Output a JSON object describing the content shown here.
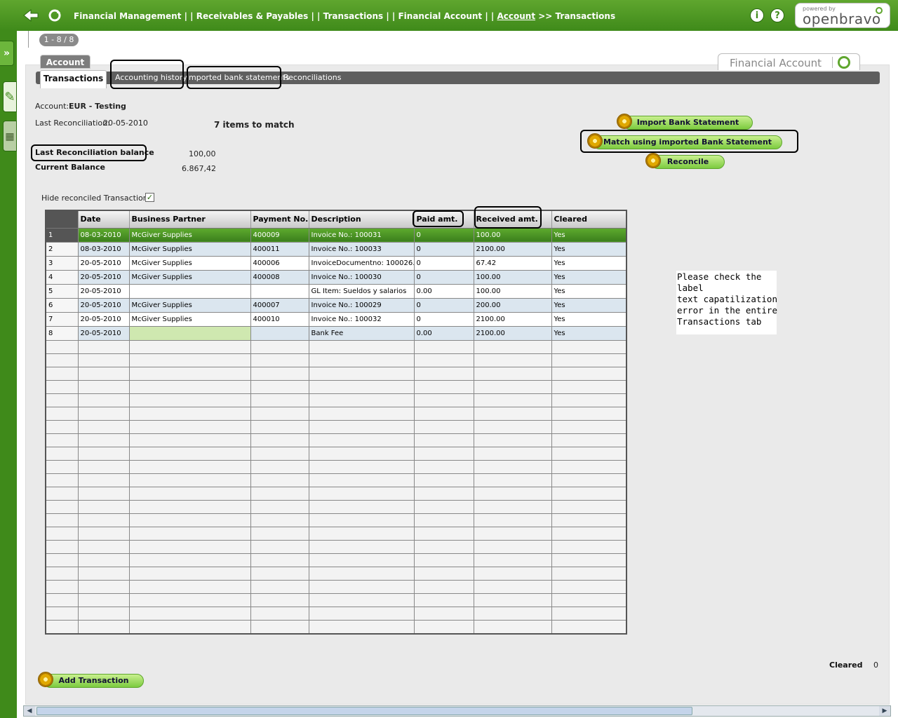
{
  "breadcrumb": {
    "parts": "Financial Management  | |  Receivables & Payables  | |  Transactions  | |  Financial Account   | |",
    "link": "Account",
    "rest": ">>  Transactions"
  },
  "logo": {
    "small": "powered by",
    "big": "openbravo"
  },
  "pager": "1 - 8 / 8",
  "tabs": {
    "account": "Account",
    "financial_account": "Financial Account",
    "transactions": "Transactions",
    "accounting_history": "Accounting history",
    "imported": "mported bank statements",
    "reconciliations": "Reconciliations"
  },
  "info": {
    "account_label": "Account:",
    "account_value": "EUR - Testing",
    "last_recon_label": "Last Reconciliation:",
    "last_recon_value": "20-05-2010",
    "items_to_match": "7  items to match",
    "last_recon_balance_label": "Last Reconciliation balance",
    "last_recon_balance_value": "100,00",
    "current_balance_label": "Current Balance",
    "current_balance_value": "6.867,42"
  },
  "buttons": {
    "import": "Import Bank Statement",
    "match": "Match using imported Bank Statement",
    "reconcile": "Reconcile",
    "add": "Add Transaction"
  },
  "hide_reconciled": {
    "label": "Hide reconciled Transactions",
    "checked": "✓"
  },
  "grid": {
    "columns": [
      "Date",
      "Business Partner",
      "Payment No.",
      "Description",
      "Paid amt.",
      "Received amt.",
      "Cleared"
    ],
    "rows": [
      {
        "n": "1",
        "date": "08-03-2010",
        "bp": "McGiver Supplies",
        "pay": "400009",
        "desc": "Invoice No.: 100031",
        "paid": "0",
        "recv": "100.00",
        "clr": "Yes"
      },
      {
        "n": "2",
        "date": "08-03-2010",
        "bp": "McGiver Supplies",
        "pay": "400011",
        "desc": "Invoice No.: 100033",
        "paid": "0",
        "recv": "2100.00",
        "clr": "Yes"
      },
      {
        "n": "3",
        "date": "20-05-2010",
        "bp": "McGiver Supplies",
        "pay": "400006",
        "desc": "InvoiceDocumentno: 100026.",
        "paid": "0",
        "recv": "67.42",
        "clr": "Yes"
      },
      {
        "n": "4",
        "date": "20-05-2010",
        "bp": "McGiver Supplies",
        "pay": "400008",
        "desc": "Invoice No.: 100030",
        "paid": "0",
        "recv": "100.00",
        "clr": "Yes"
      },
      {
        "n": "5",
        "date": "20-05-2010",
        "bp": "",
        "pay": "",
        "desc": "GL Item: Sueldos y salarios",
        "paid": "0.00",
        "recv": "100.00",
        "clr": "Yes"
      },
      {
        "n": "6",
        "date": "20-05-2010",
        "bp": "McGiver Supplies",
        "pay": "400007",
        "desc": "Invoice No.: 100029",
        "paid": "0",
        "recv": "200.00",
        "clr": "Yes"
      },
      {
        "n": "7",
        "date": "20-05-2010",
        "bp": "McGiver Supplies",
        "pay": "400010",
        "desc": "Invoice No.: 100032",
        "paid": "0",
        "recv": "2100.00",
        "clr": "Yes"
      },
      {
        "n": "8",
        "date": "20-05-2010",
        "bp": "",
        "pay": "",
        "desc": "Bank Fee",
        "paid": "0.00",
        "recv": "2100.00",
        "clr": "Yes"
      }
    ]
  },
  "note": "Please check the\nlabel\ntext capatilization\nerror in the entire\nTransactions tab",
  "footer": {
    "cleared_label": "Cleared",
    "cleared_value": "0"
  }
}
